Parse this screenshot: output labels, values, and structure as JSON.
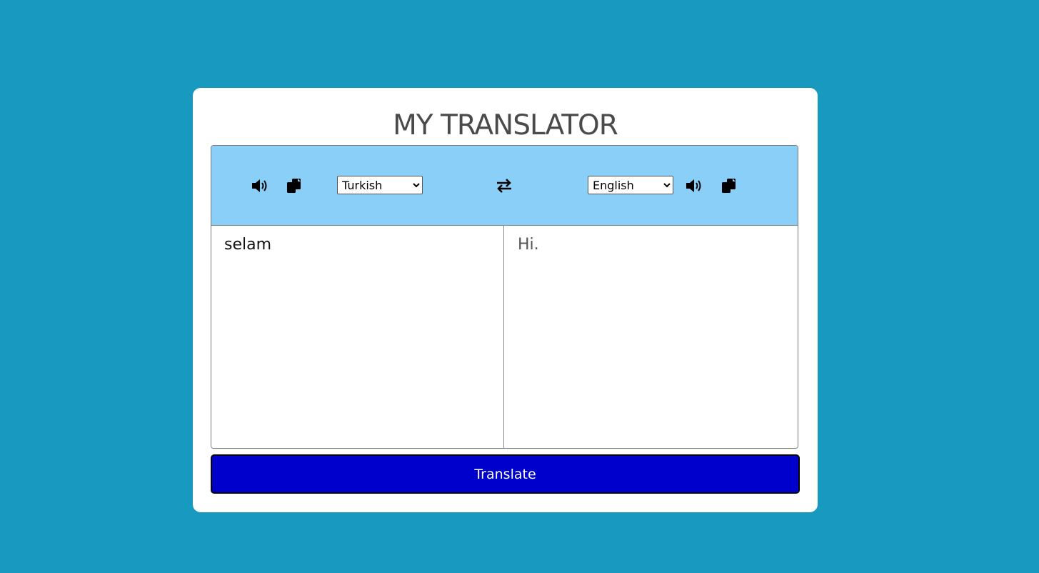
{
  "app": {
    "title": "MY TRANSLATOR"
  },
  "source": {
    "language": "Turkish",
    "text": "selam",
    "languages": [
      "Turkish",
      "English"
    ]
  },
  "target": {
    "language": "English",
    "text": "Hi.",
    "languages": [
      "English",
      "Turkish"
    ]
  },
  "actions": {
    "translate_label": "Translate"
  },
  "icons": {
    "speak": "volume-icon",
    "copy": "copy-icon",
    "swap": "exchange-icon"
  },
  "colors": {
    "background": "#1899c0",
    "toolbar": "#89cff8",
    "button": "#0000cd"
  }
}
